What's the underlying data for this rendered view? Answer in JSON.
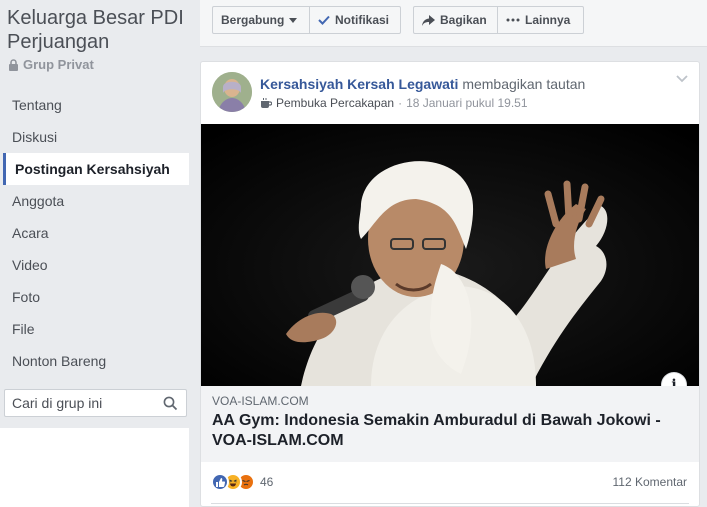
{
  "group": {
    "title": "Keluarga Besar PDI Perjuangan",
    "privacy": "Grup Privat"
  },
  "nav": {
    "items": [
      {
        "label": "Tentang"
      },
      {
        "label": "Diskusi"
      },
      {
        "label": "Postingan Kersahsiyah"
      },
      {
        "label": "Anggota"
      },
      {
        "label": "Acara"
      },
      {
        "label": "Video"
      },
      {
        "label": "Foto"
      },
      {
        "label": "File"
      },
      {
        "label": "Nonton Bareng"
      }
    ]
  },
  "search": {
    "placeholder": "Cari di grup ini"
  },
  "toolbar": {
    "join": "Bergabung",
    "notify": "Notifikasi",
    "share": "Bagikan",
    "more": "Lainnya"
  },
  "post": {
    "author": "Kersahsiyah Kersah Legawati",
    "action": "membagikan tautan",
    "topic": "Pembuka Percakapan",
    "separator": "·",
    "time": "18 Januari pukul 19.51",
    "link": {
      "domain": "VOA-ISLAM.COM",
      "headline": "AA Gym: Indonesia Semakin Amburadul di Bawah Jokowi - VOA-ISLAM.COM"
    },
    "reaction_count": "46",
    "comments": "112 Komentar"
  },
  "colors": {
    "accent": "#4267b2",
    "link": "#365899",
    "background": "#e9ebee"
  }
}
